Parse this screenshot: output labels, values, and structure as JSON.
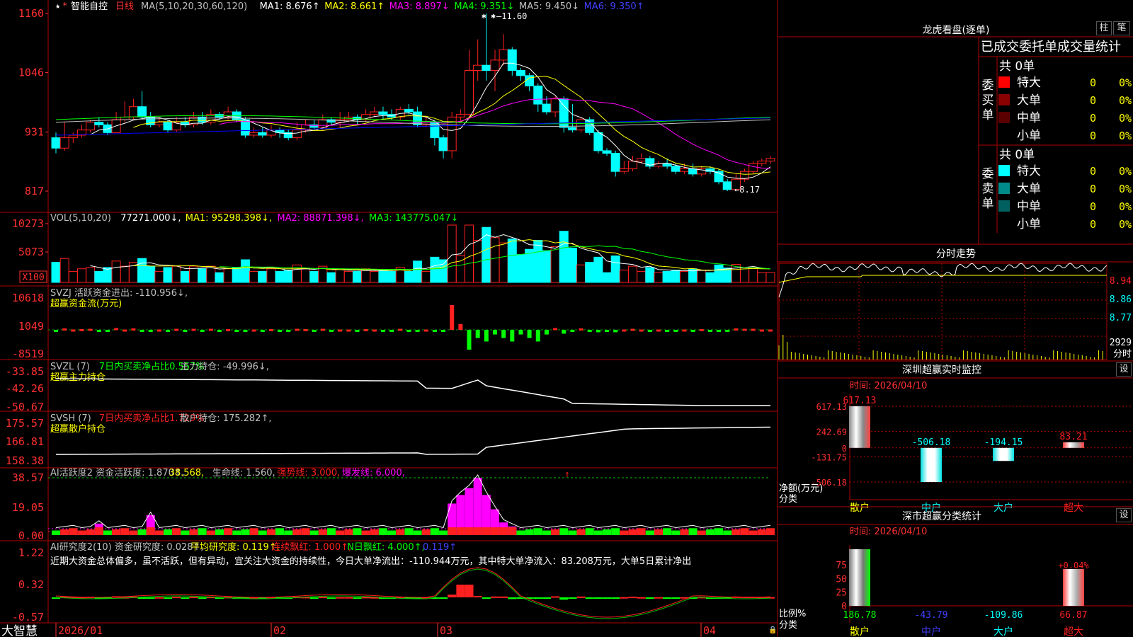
{
  "stock": {
    "name": "智能自控",
    "period": "日线"
  },
  "colors": {
    "up": "#ff2020",
    "down": "#00ffff",
    "ma1": "#ffffff",
    "ma2": "#ffff00",
    "ma3": "#ff00ff",
    "ma4": "#00ff00",
    "ma5": "#c0c0c0",
    "ma6": "#0000ff",
    "grid": "#b00000",
    "axis_text": "#ff3030"
  },
  "main_panel": {
    "legend": [
      {
        "text": "MA(5,10,20,30,60,120)",
        "color": "#c0c0c0"
      },
      {
        "text": "MA1: 8.676↑",
        "color": "#ffffff"
      },
      {
        "text": "MA2: 8.661↑",
        "color": "#ffff00"
      },
      {
        "text": "MA3: 8.897↓",
        "color": "#ff00ff"
      },
      {
        "text": "MA4: 9.351↓",
        "color": "#00ff00"
      },
      {
        "text": "MA5: 9.450↓",
        "color": "#c0c0c0"
      },
      {
        "text": "MA6: 9.350↑",
        "color": "#4040ff"
      }
    ],
    "y_ticks": [
      "1160",
      "1046",
      "931",
      "817"
    ],
    "high_label": "11.60",
    "low_label": "←8.17"
  },
  "vol_panel": {
    "legend": [
      {
        "text": "VOL(5,10,20)",
        "color": "#c0c0c0"
      },
      {
        "text": "77271.000↓,",
        "color": "#ffffff"
      },
      {
        "text": "MA1: 95298.398↓,",
        "color": "#ffff00"
      },
      {
        "text": "MA2: 88871.398↓,",
        "color": "#ff00ff"
      },
      {
        "text": "MA3: 143775.047↓",
        "color": "#00ff00"
      }
    ],
    "y_ticks": [
      "10273",
      "5073"
    ],
    "unit_label": "X100"
  },
  "svzj_panel": {
    "legend": [
      {
        "text": "SVZJ  活跃资金进出: -110.956↓,",
        "color": "#c0c0c0"
      }
    ],
    "title": "超赢资金流(万元)",
    "y_ticks": [
      "10618",
      "1049",
      "-8519"
    ]
  },
  "svzl_panel": {
    "legend": [
      {
        "text": "SVZL (7)",
        "color": "#c0c0c0"
      },
      {
        "text": "7日内买卖净占比0.557%",
        "color": "#00ff00"
      },
      {
        "text": "主力持仓: -49.996↓,",
        "color": "#c0c0c0"
      }
    ],
    "title": "超赢主力持仓",
    "y_ticks": [
      "-33.85",
      "-42.26",
      "-50.67"
    ]
  },
  "svsh_panel": {
    "legend": [
      {
        "text": "SVSH (7)",
        "color": "#c0c0c0"
      },
      {
        "text": "7日内买卖净占比1.729%",
        "color": "#ff2020"
      },
      {
        "text": "散户持仓: 175.282↑,",
        "color": "#c0c0c0"
      }
    ],
    "title": "超赢散户持仓",
    "y_ticks": [
      "175.57",
      "166.81",
      "158.38"
    ]
  },
  "ai1_panel": {
    "legend": [
      {
        "text": "AI活跃度2 资金活跃度: 1.870↑,",
        "color": "#c0c0c0"
      },
      {
        "text": "38.568,",
        "color": "#ffff00"
      },
      {
        "text": "生命线: 1.560,",
        "color": "#c0c0c0"
      },
      {
        "text": "强势线: 3.000,",
        "color": "#ff2020"
      },
      {
        "text": "爆发线: 6.000,",
        "color": "#ff00ff"
      }
    ],
    "y_ticks": [
      "38.57",
      "19.05",
      "0.00"
    ]
  },
  "ai2_panel": {
    "legend": [
      {
        "text": "AI研究度2(10) 资金研究度: 0.028↑,",
        "color": "#c0c0c0"
      },
      {
        "text": "平均研究度: 0.119↑,",
        "color": "#ffff00"
      },
      {
        "text": "连续飘红: 1.000↑,",
        "color": "#ff2020"
      },
      {
        "text": "N日飘红: 4.000↑,",
        "color": "#00ff00"
      },
      {
        "text": "0.119↑",
        "color": "#4040ff"
      }
    ],
    "commentary": "近期大资金总体偏多，虽不活跃，但有异动，宜关注大资金的持续性，今日大单净流出：-110.944万元，其中特大单净流入：83.208万元，大单5日累计净出",
    "y_ticks": [
      "1.22",
      "0.32",
      "-0.57"
    ]
  },
  "x_axis": {
    "labels": [
      "2026/01",
      "02",
      "03",
      "04"
    ],
    "brand": "大智慧"
  },
  "longhu": {
    "title": "龙虎看盘(逐单)",
    "btn_bar": "柱",
    "btn_tick": "笔",
    "header": "已成交委托单成交量统计",
    "buy": {
      "label": "委买单",
      "total": "共 0单",
      "rows": [
        {
          "name": "特大",
          "count": "0",
          "pct": "0%",
          "color": "#ff0000"
        },
        {
          "name": "大单",
          "count": "0",
          "pct": "0%",
          "color": "#8b0000"
        },
        {
          "name": "中单",
          "count": "0",
          "pct": "0%",
          "color": "#5a0000"
        },
        {
          "name": "小单",
          "count": "0",
          "pct": "0%",
          "color": ""
        }
      ]
    },
    "sell": {
      "label": "委卖单",
      "total": "共 0单",
      "rows": [
        {
          "name": "特大",
          "count": "0",
          "pct": "0%",
          "color": "#00ffff"
        },
        {
          "name": "大单",
          "count": "0",
          "pct": "0%",
          "color": "#008b8b"
        },
        {
          "name": "中单",
          "count": "0",
          "pct": "0%",
          "color": "#006060"
        },
        {
          "name": "小单",
          "count": "0",
          "pct": "0%",
          "color": ""
        }
      ]
    }
  },
  "intraday": {
    "title": "分时走势",
    "price_labels": [
      "8.94",
      "8.86",
      "8.77"
    ],
    "vol_label": "2929",
    "unit": "分时"
  },
  "monitor": {
    "title": "深圳超赢实时监控",
    "btn": "设",
    "time": "时间: 2026/04/10",
    "y_ticks": [
      "617.13",
      "242.69",
      "0",
      "-131.75",
      "-506.18"
    ],
    "ylabel": "净额(万元)",
    "xlabel": "分类",
    "categories": [
      "散户",
      "中户",
      "大户",
      "超大"
    ],
    "values": [
      617.13,
      -506.18,
      -194.15,
      83.21
    ],
    "value_labels": [
      "617.13",
      "-506.18",
      "-194.15",
      "83.21"
    ]
  },
  "classify": {
    "title": "深市超赢分类统计",
    "btn": "设",
    "time": "时间: 2026/04/10",
    "y_ticks": [
      "75",
      "50",
      "25",
      "0"
    ],
    "ylabel": "比例%",
    "xlabel": "分类",
    "categories": [
      "散户",
      "中户",
      "大户",
      "超大"
    ],
    "values": [
      186.78,
      -43.79,
      -109.86,
      66.87
    ],
    "value_labels": [
      "186.78",
      "-43.79",
      "-109.86",
      "66.87"
    ],
    "pct_label": "+0.04%"
  },
  "chart_data": [
    {
      "type": "candlestick",
      "title": "智能自控 日线",
      "x": [
        "2026/01",
        "02",
        "03",
        "04"
      ],
      "ylim": [
        8.17,
        11.6
      ],
      "series": [
        {
          "name": "K",
          "values": [
            [
              9.2,
              9.0,
              9.3,
              8.9
            ],
            [
              9.0,
              9.2,
              9.5,
              8.95
            ],
            [
              9.2,
              9.25,
              9.3,
              9.1
            ],
            [
              9.25,
              9.35,
              9.45,
              9.2
            ],
            [
              9.35,
              9.5,
              9.55,
              9.3
            ],
            [
              9.5,
              9.45,
              9.6,
              9.4
            ],
            [
              9.45,
              9.3,
              9.5,
              9.25
            ],
            [
              9.3,
              9.55,
              9.7,
              9.3
            ],
            [
              9.55,
              9.6,
              9.9,
              9.5
            ],
            [
              9.6,
              9.8,
              9.95,
              9.55
            ],
            [
              9.8,
              9.6,
              10.1,
              9.55
            ],
            [
              9.6,
              9.45,
              9.7,
              9.4
            ],
            [
              9.45,
              9.5,
              9.6,
              9.4
            ],
            [
              9.5,
              9.35,
              9.55,
              9.3
            ],
            [
              9.35,
              9.5,
              9.6,
              9.3
            ],
            [
              9.5,
              9.45,
              9.6,
              9.4
            ],
            [
              9.45,
              9.6,
              9.7,
              9.4
            ],
            [
              9.6,
              9.5,
              9.7,
              9.45
            ],
            [
              9.5,
              9.65,
              9.75,
              9.45
            ],
            [
              9.65,
              9.6,
              9.7,
              9.55
            ],
            [
              9.6,
              9.7,
              9.8,
              9.55
            ],
            [
              9.7,
              9.55,
              9.75,
              9.5
            ],
            [
              9.55,
              9.25,
              9.6,
              9.2
            ],
            [
              9.25,
              9.3,
              9.4,
              9.2
            ],
            [
              9.3,
              9.25,
              9.4,
              9.2
            ],
            [
              9.25,
              9.35,
              9.45,
              9.2
            ],
            [
              9.35,
              9.3,
              9.4,
              9.2
            ],
            [
              9.3,
              9.2,
              9.35,
              9.15
            ],
            [
              9.2,
              9.35,
              9.5,
              9.15
            ],
            [
              9.35,
              9.45,
              9.55,
              9.3
            ],
            [
              9.45,
              9.4,
              9.55,
              9.35
            ],
            [
              9.4,
              9.55,
              9.65,
              9.35
            ],
            [
              9.55,
              9.5,
              9.6,
              9.45
            ],
            [
              9.5,
              9.55,
              9.7,
              9.4
            ],
            [
              9.55,
              9.6,
              9.7,
              9.5
            ],
            [
              9.6,
              9.55,
              9.65,
              9.45
            ],
            [
              9.55,
              9.65,
              9.75,
              9.5
            ],
            [
              9.65,
              9.7,
              9.8,
              9.6
            ],
            [
              9.7,
              9.65,
              9.8,
              9.55
            ],
            [
              9.65,
              9.6,
              9.75,
              9.55
            ],
            [
              9.6,
              9.75,
              9.8,
              9.55
            ],
            [
              9.75,
              9.7,
              9.85,
              9.65
            ],
            [
              9.7,
              9.45,
              9.8,
              9.4
            ],
            [
              9.45,
              9.5,
              9.6,
              9.4
            ],
            [
              9.5,
              9.2,
              9.55,
              9.05
            ],
            [
              9.2,
              8.95,
              9.25,
              8.8
            ],
            [
              8.95,
              9.6,
              9.7,
              8.8
            ],
            [
              9.6,
              9.65,
              9.75,
              9.5
            ],
            [
              9.65,
              10.5,
              10.9,
              9.6
            ],
            [
              10.5,
              10.6,
              11.1,
              10.3
            ],
            [
              10.6,
              10.5,
              11.6,
              10.3
            ],
            [
              10.5,
              10.7,
              10.9,
              10.1
            ],
            [
              10.7,
              10.9,
              11.2,
              10.6
            ],
            [
              10.9,
              10.5,
              10.95,
              10.4
            ],
            [
              10.5,
              10.4,
              10.55,
              10.3
            ],
            [
              10.4,
              10.2,
              10.45,
              10.1
            ],
            [
              10.2,
              9.85,
              10.25,
              9.7
            ],
            [
              9.85,
              9.7,
              10.0,
              9.65
            ],
            [
              9.7,
              9.95,
              10.0,
              9.6
            ],
            [
              9.95,
              9.4,
              10.0,
              9.3
            ],
            [
              9.4,
              9.35,
              9.85,
              9.3
            ],
            [
              9.35,
              9.55,
              9.6,
              9.3
            ],
            [
              9.55,
              9.3,
              9.6,
              9.25
            ],
            [
              9.3,
              8.95,
              9.35,
              8.9
            ],
            [
              8.95,
              8.9,
              9.0,
              8.85
            ],
            [
              8.9,
              8.55,
              8.95,
              8.45
            ],
            [
              8.55,
              8.6,
              8.75,
              8.5
            ],
            [
              8.6,
              8.75,
              8.85,
              8.55
            ],
            [
              8.75,
              8.8,
              8.9,
              8.7
            ],
            [
              8.8,
              8.65,
              8.85,
              8.6
            ],
            [
              8.65,
              8.7,
              8.75,
              8.6
            ],
            [
              8.7,
              8.65,
              8.8,
              8.6
            ],
            [
              8.65,
              8.55,
              8.7,
              8.5
            ],
            [
              8.55,
              8.6,
              8.7,
              8.5
            ],
            [
              8.6,
              8.5,
              8.7,
              8.45
            ],
            [
              8.5,
              8.6,
              8.65,
              8.45
            ],
            [
              8.6,
              8.55,
              8.65,
              8.5
            ],
            [
              8.55,
              8.35,
              8.6,
              8.3
            ],
            [
              8.35,
              8.2,
              8.4,
              8.17
            ],
            [
              8.2,
              8.4,
              8.5,
              8.18
            ],
            [
              8.4,
              8.55,
              8.6,
              8.35
            ],
            [
              8.55,
              8.7,
              8.75,
              8.5
            ],
            [
              8.7,
              8.75,
              8.8,
              8.65
            ],
            [
              8.75,
              8.8,
              8.85,
              8.7
            ]
          ]
        }
      ]
    },
    {
      "type": "bar",
      "title": "深圳超赢实时监控",
      "categories": [
        "散户",
        "中户",
        "大户",
        "超大"
      ],
      "values": [
        617.13,
        -506.18,
        -194.15,
        83.21
      ],
      "ylabel": "净额(万元)",
      "xlabel": "分类",
      "ylim": [
        -506.18,
        617.13
      ]
    },
    {
      "type": "bar",
      "title": "深市超赢分类统计",
      "categories": [
        "散户",
        "中户",
        "大户",
        "超大"
      ],
      "values": [
        186.78,
        -43.79,
        -109.86,
        66.87
      ],
      "ylabel": "比例%",
      "xlabel": "分类",
      "ylim": [
        0,
        75
      ]
    }
  ]
}
